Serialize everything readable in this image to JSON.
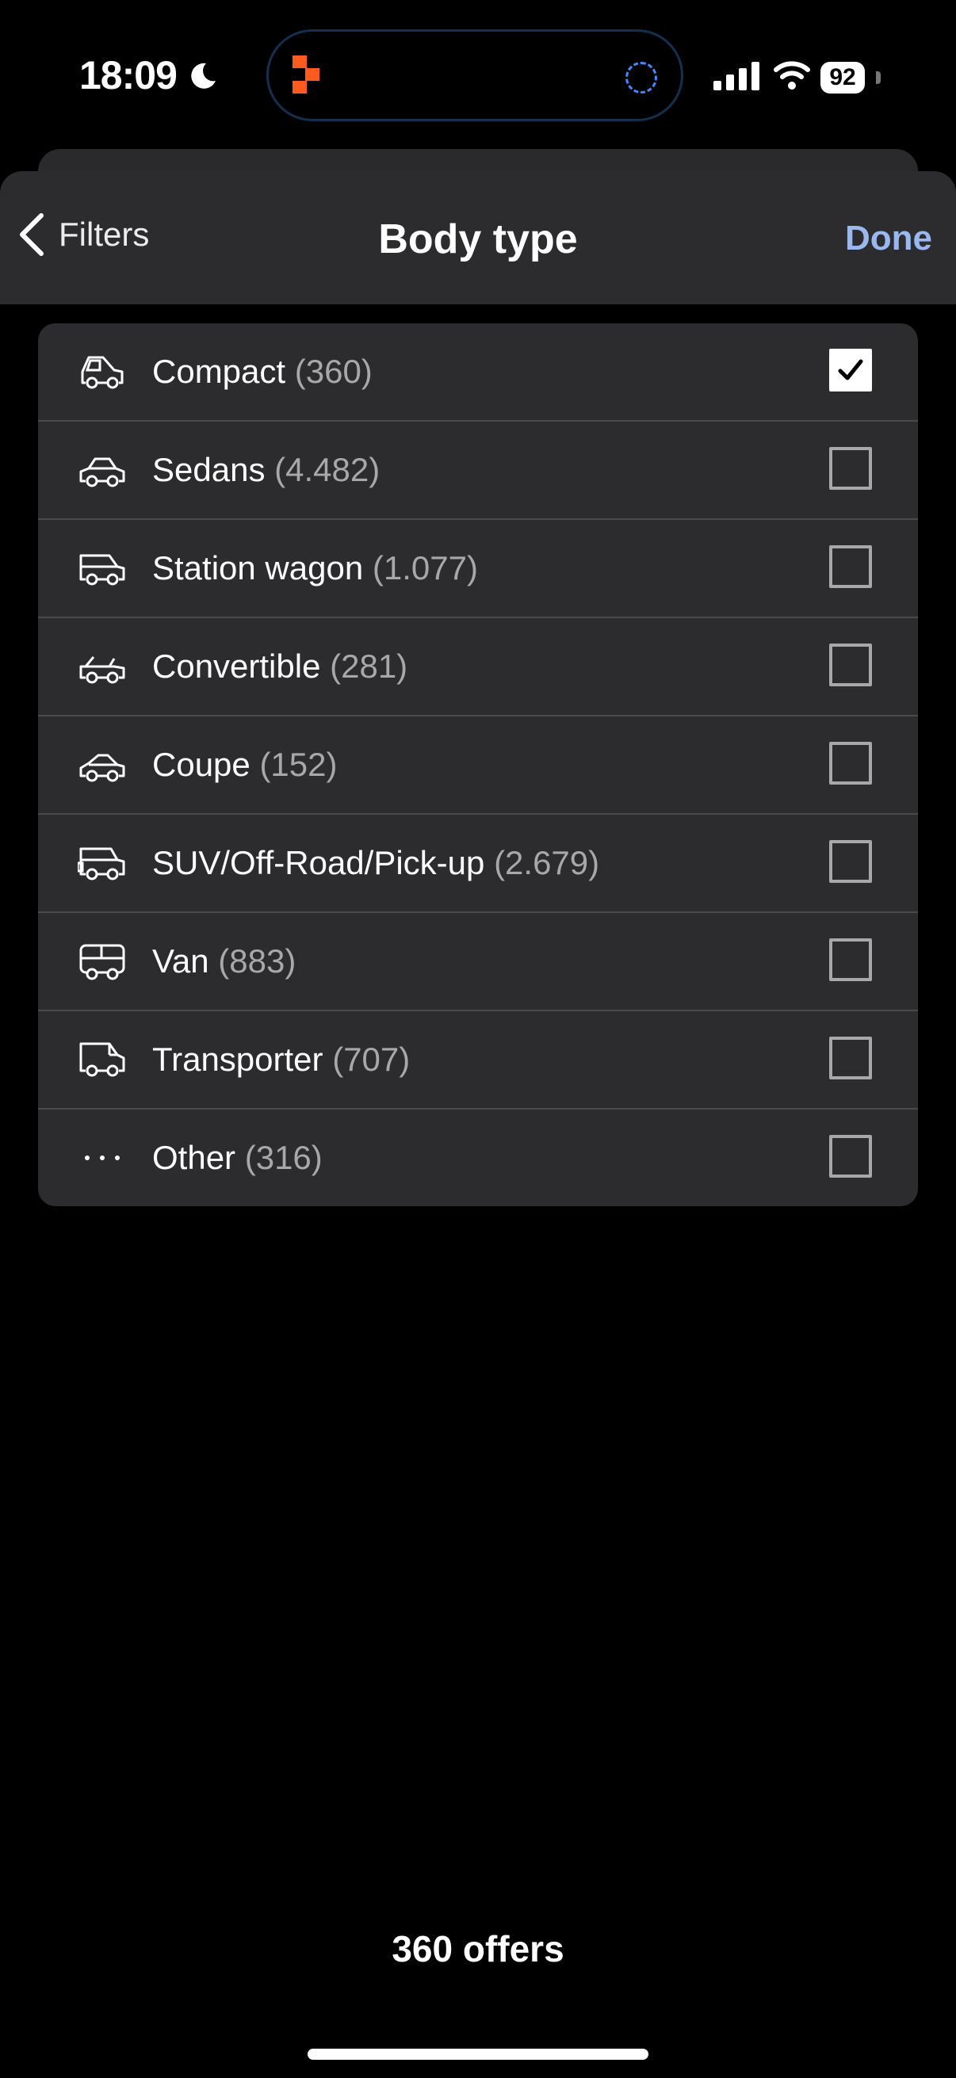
{
  "status_bar": {
    "time": "18:09",
    "battery": "92",
    "icons": [
      "moon-icon",
      "signal-icon",
      "wifi-icon",
      "battery-icon"
    ]
  },
  "header": {
    "back_label": "Filters",
    "title": "Body type",
    "done_label": "Done",
    "accent_color": "#9ab8f0"
  },
  "body_types": [
    {
      "label": "Compact",
      "count": "(360)",
      "checked": true,
      "icon": "compact-car-icon"
    },
    {
      "label": "Sedans",
      "count": "(4.482)",
      "checked": false,
      "icon": "sedan-icon"
    },
    {
      "label": "Station wagon",
      "count": "(1.077)",
      "checked": false,
      "icon": "station-wagon-icon"
    },
    {
      "label": "Convertible",
      "count": "(281)",
      "checked": false,
      "icon": "convertible-icon"
    },
    {
      "label": "Coupe",
      "count": "(152)",
      "checked": false,
      "icon": "coupe-icon"
    },
    {
      "label": "SUV/Off-Road/Pick-up",
      "count": "(2.679)",
      "checked": false,
      "icon": "suv-icon"
    },
    {
      "label": "Van",
      "count": "(883)",
      "checked": false,
      "icon": "van-icon"
    },
    {
      "label": "Transporter",
      "count": "(707)",
      "checked": false,
      "icon": "transporter-icon"
    },
    {
      "label": "Other",
      "count": "(316)",
      "checked": false,
      "icon": "more-dots-icon"
    }
  ],
  "footer": {
    "offers_label": "360 offers"
  }
}
